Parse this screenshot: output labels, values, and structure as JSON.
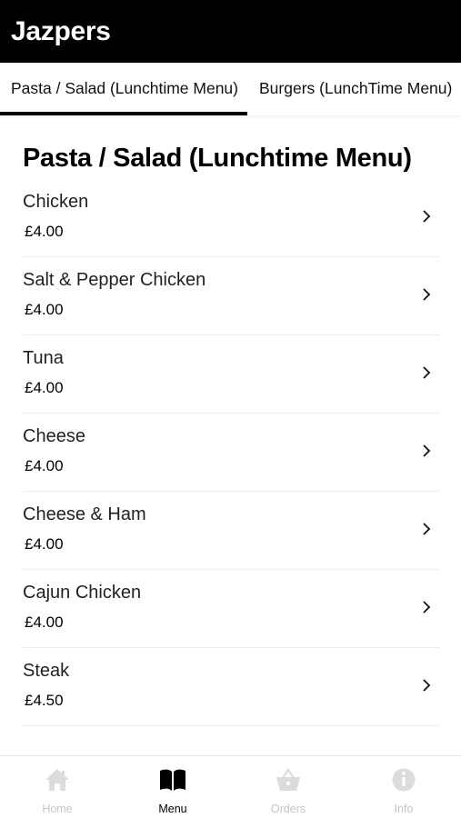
{
  "app": {
    "title": "Jazpers"
  },
  "tabs": [
    {
      "label": "Pasta / Salad (Lunchtime Menu)",
      "active": true
    },
    {
      "label": "Burgers (LunchTime Menu)",
      "active": false
    }
  ],
  "section": {
    "title": "Pasta / Salad (Lunchtime Menu)"
  },
  "items": [
    {
      "name": "Chicken",
      "price": "£4.00"
    },
    {
      "name": "Salt & Pepper Chicken",
      "price": "£4.00"
    },
    {
      "name": "Tuna",
      "price": "£4.00"
    },
    {
      "name": "Cheese",
      "price": "£4.00"
    },
    {
      "name": "Cheese & Ham",
      "price": "£4.00"
    },
    {
      "name": "Cajun Chicken",
      "price": "£4.00"
    },
    {
      "name": "Steak",
      "price": "£4.50"
    }
  ],
  "bottom_nav": [
    {
      "label": "Home",
      "icon": "home-icon",
      "active": false
    },
    {
      "label": "Menu",
      "icon": "book-icon",
      "active": true
    },
    {
      "label": "Orders",
      "icon": "basket-icon",
      "active": false
    },
    {
      "label": "Info",
      "icon": "info-icon",
      "active": false
    }
  ],
  "colors": {
    "header_bg": "#000000",
    "active": "#000000",
    "inactive": "#c4c4c4"
  }
}
